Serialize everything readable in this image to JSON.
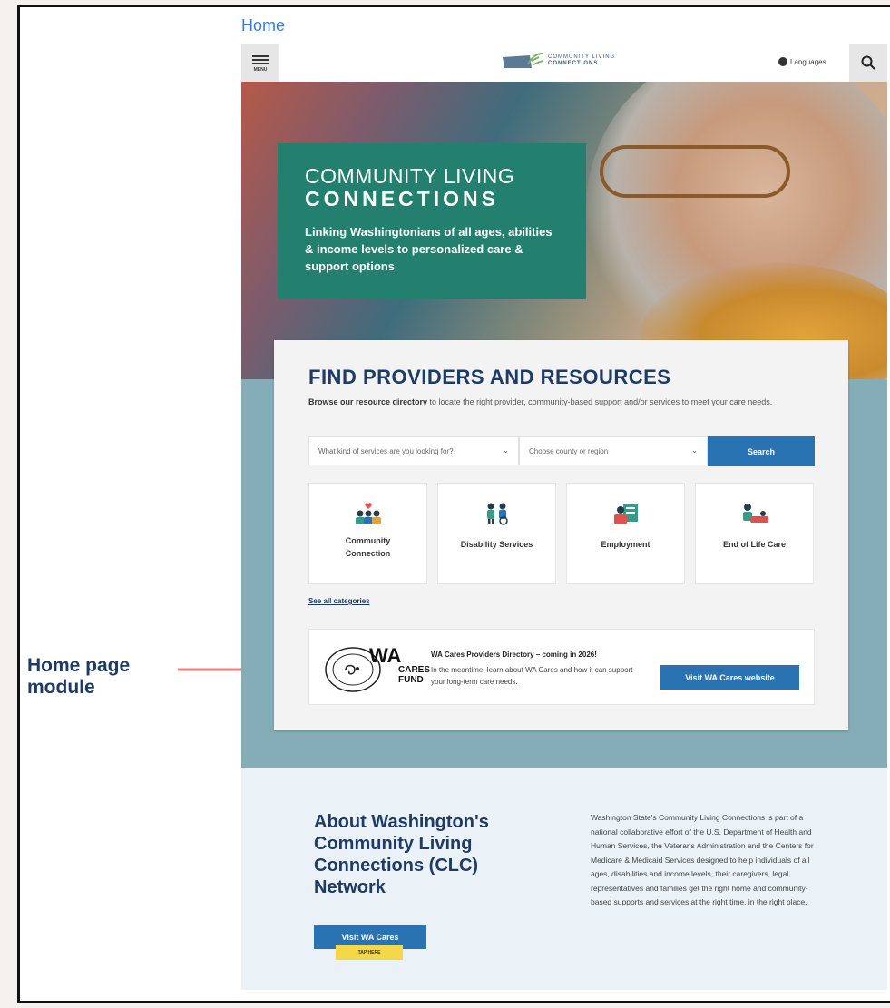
{
  "page_label": "Home",
  "annotation": {
    "label_line1": "Home page",
    "label_line2": "module"
  },
  "header": {
    "menu_label": "MENU",
    "logo_line1": "COMMUNITY LIVING",
    "logo_line2": "CONNECTIONS",
    "languages_label": "Languages"
  },
  "hero": {
    "title_line1": "COMMUNITY LIVING",
    "title_line2": "CONNECTIONS",
    "subtitle": "Linking Washingtonians of all ages, abilities & income levels to personalized care & support options"
  },
  "find": {
    "title": "FIND PROVIDERS AND RESOURCES",
    "desc_bold": "Browse our resource directory",
    "desc_rest": " to locate the right provider, community-based support and/or services to meet your care needs.",
    "service_placeholder": "What kind of services are you looking for?",
    "county_placeholder": "Choose county or region",
    "search_label": "Search",
    "categories": [
      {
        "label": "Community Connection"
      },
      {
        "label": "Disability Services"
      },
      {
        "label": "Employment"
      },
      {
        "label": "End of Life Care"
      }
    ],
    "see_all": "See all categories"
  },
  "wa_cares": {
    "logo_wa": "WA",
    "logo_cares": "CARES",
    "logo_fund": "FUND",
    "title": "WA Cares Providers Directory – coming in 2026!",
    "body": "In the meantime, learn about WA Cares and how it can support your long-term care needs.",
    "button": "Visit WA Cares website"
  },
  "about": {
    "title": "About Washington's Community Living Connections (CLC) Network",
    "button": "Visit WA Cares",
    "tag": "TAP HERE",
    "body": "Washington State's Community Living Connections is part of a national collaborative effort of the U.S. Department of Health and Human Services, the Veterans Administration and the Centers for Medicare & Medicaid Services designed to help individuals of all ages, disabilities and income levels, their caregivers, legal representatives and families get the right home and community-based supports and services at the right time, in the right place."
  },
  "colors": {
    "teal": "#23806f",
    "navy": "#1d3b66",
    "blue_button": "#2a73b2",
    "band": "#85adb8",
    "about_bg": "#eaf1f7",
    "arrow": "#f08080"
  },
  "icons": [
    "menu-icon",
    "logo-mark-icon",
    "globe-icon",
    "search-icon",
    "chevron-down-icon",
    "community-connection-icon",
    "disability-services-icon",
    "employment-icon",
    "end-of-life-care-icon",
    "wa-cares-fund-logo"
  ]
}
